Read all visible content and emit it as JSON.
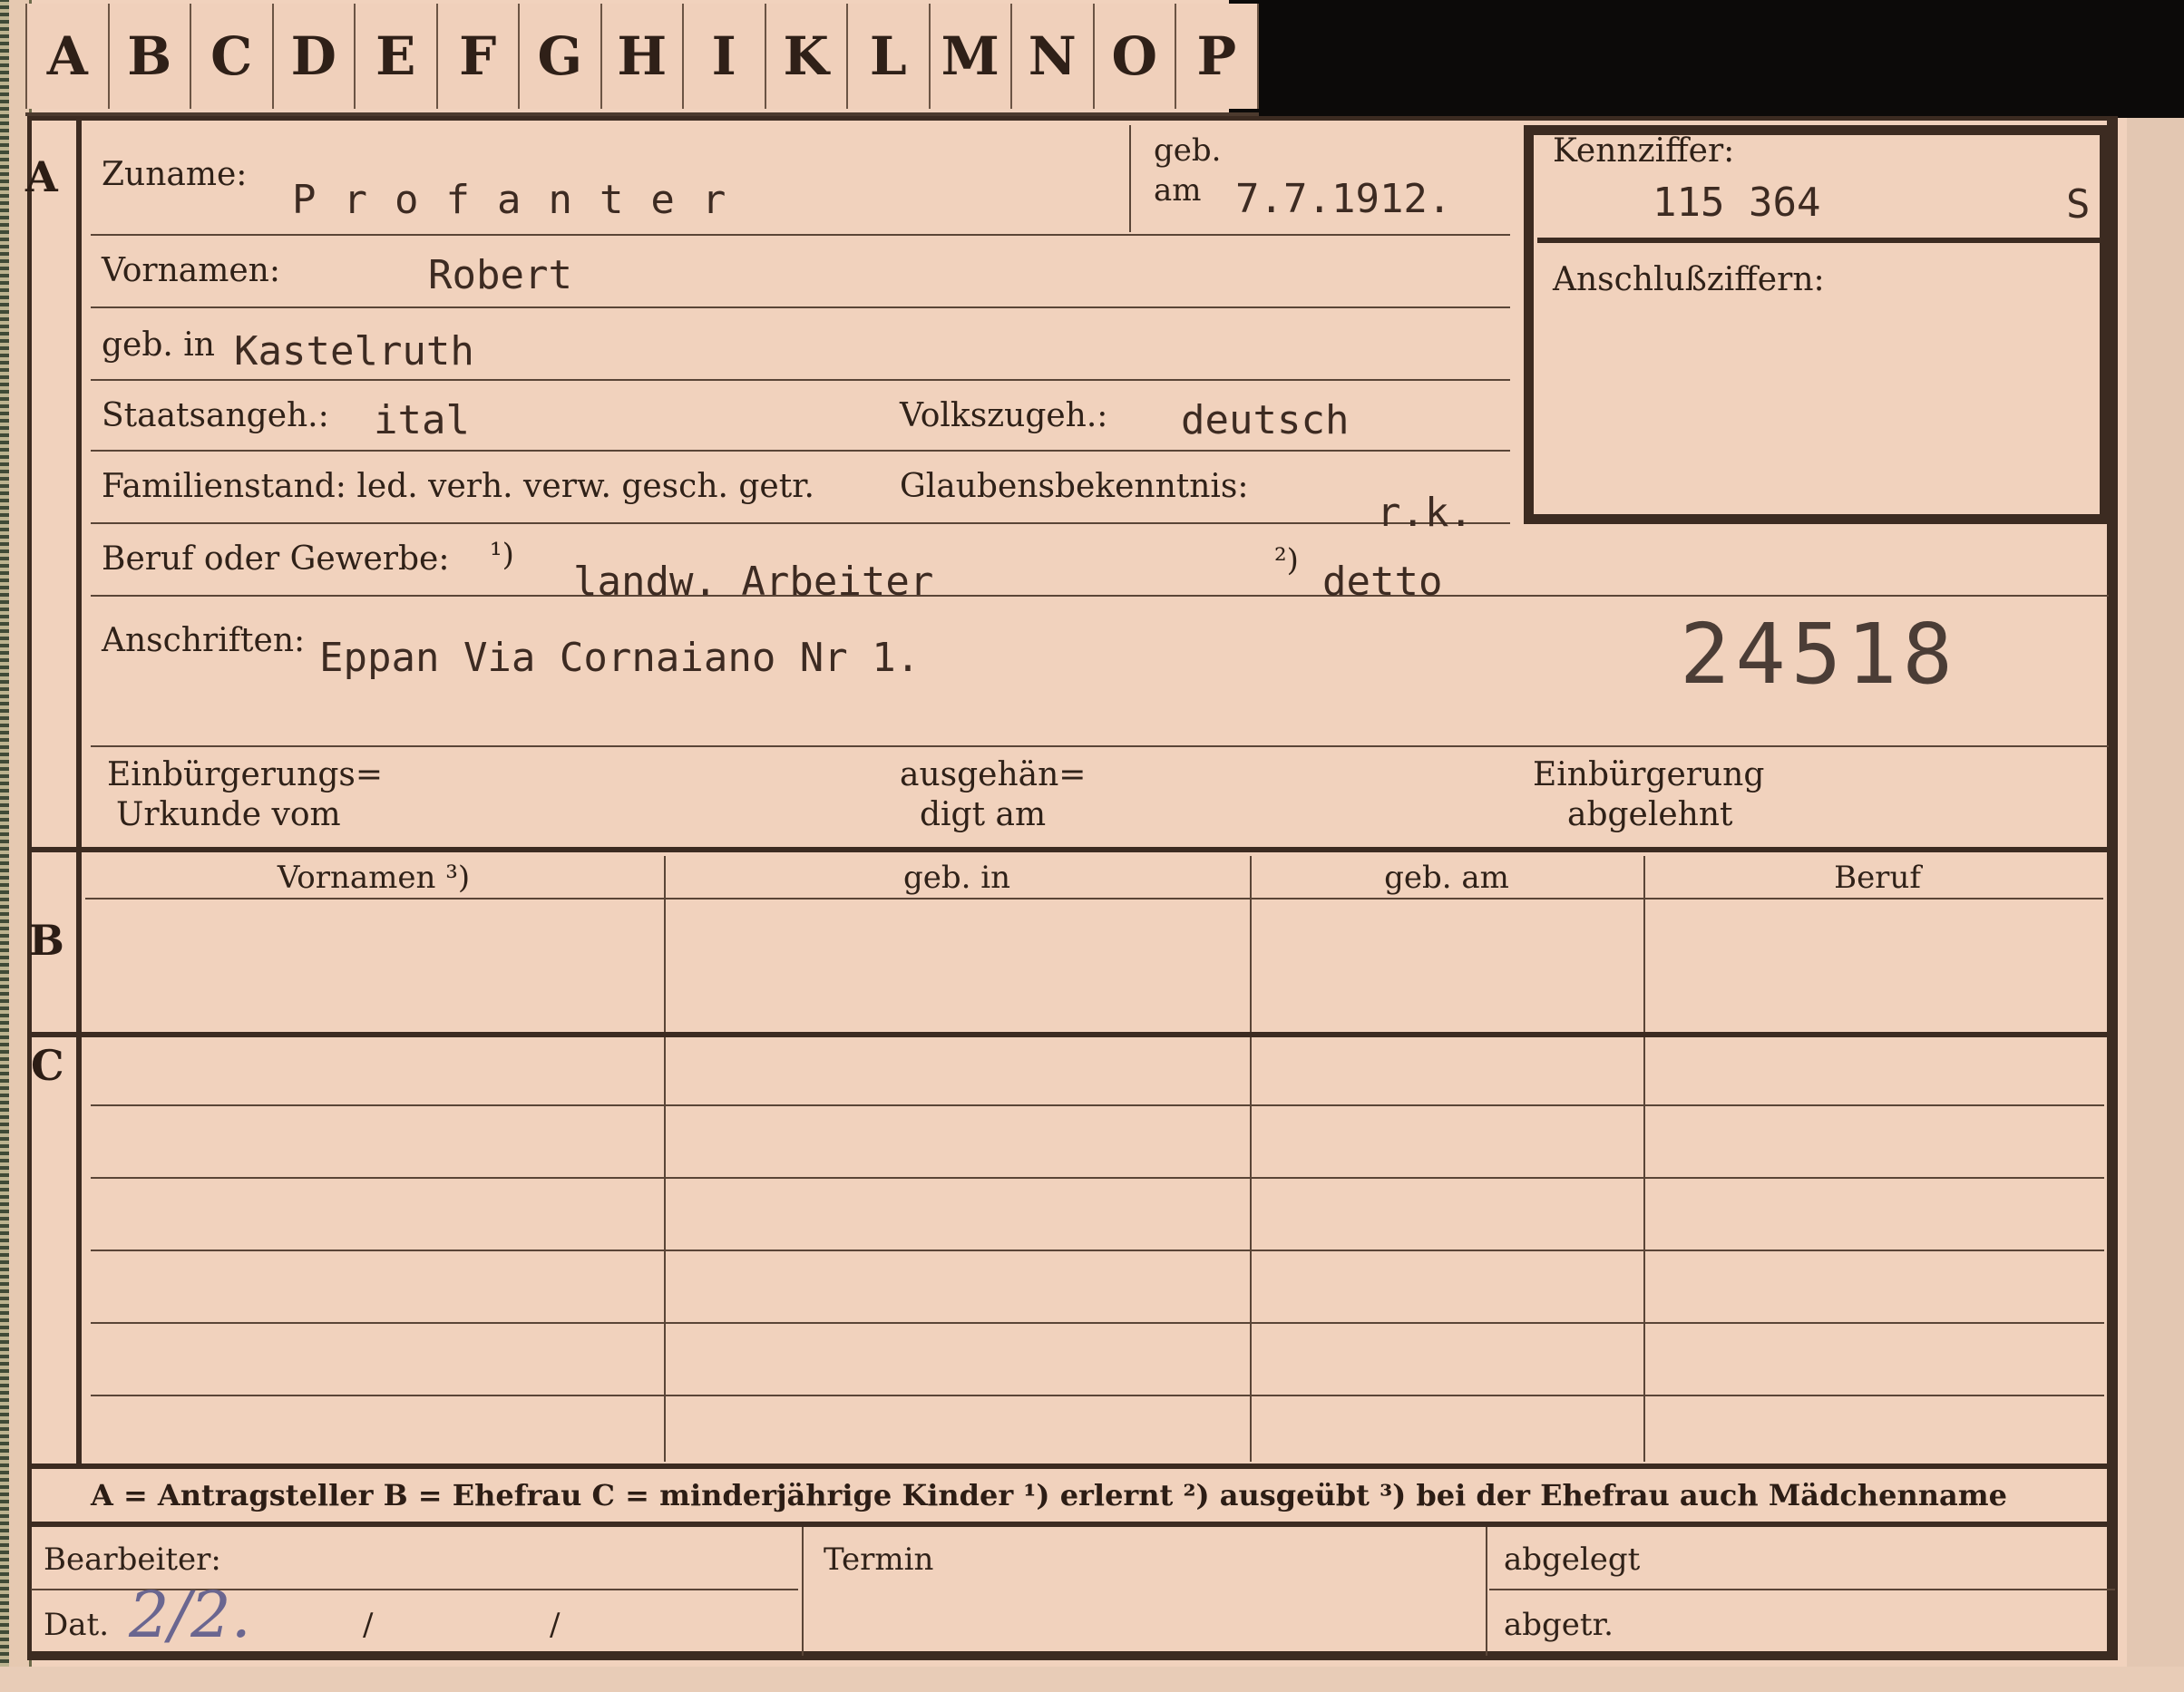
{
  "tabs": [
    "A",
    "B",
    "C",
    "D",
    "E",
    "F",
    "G",
    "H",
    "I",
    "K",
    "L",
    "M",
    "N",
    "O",
    "P"
  ],
  "section_a": {
    "label": "A",
    "zuname_label": "Zuname:",
    "zuname": "Profanter",
    "geb_label": "geb.",
    "am_label": "am",
    "geb_am": "7.7.1912.",
    "vornamen_label": "Vornamen:",
    "vornamen": "Robert",
    "geb_in_label": "geb. in",
    "geb_in": "Kastelruth",
    "staat_label": "Staatsangeh.:",
    "staat": "ital",
    "volk_label": "Volkszugeh.:",
    "volk": "deutsch",
    "familienstand_label": "Familienstand: led. verh. verw. gesch. getr.",
    "glauben_label": "Glaubensbekenntnis:",
    "glauben": "r.k.",
    "beruf_label": "Beruf oder Gewerbe:",
    "fn1": "¹)",
    "beruf_erlernt": "landw. Arbeiter",
    "fn2": "²)",
    "beruf_ausgeuebt": "detto",
    "anschriften_label": "Anschriften:",
    "anschrift": "Eppan Via Cornaiano Nr 1.",
    "stamp_number": "24518",
    "einb_urkunde_l1": "Einbürgerungs=",
    "einb_urkunde_l2": "Urkunde vom",
    "ausgehaendigt_l1": "ausgehän=",
    "ausgehaendigt_l2": "digt am",
    "einb_abgelehnt_l1": "Einbürgerung",
    "einb_abgelehnt_l2": "abgelehnt"
  },
  "kennziffer": {
    "label": "Kennziffer:",
    "value": "115 364",
    "suffix": "S",
    "anschluss_label": "Anschlußziffern:"
  },
  "section_b": {
    "label": "B",
    "columns": [
      "Vornamen ³)",
      "geb. in",
      "geb. am",
      "Beruf"
    ]
  },
  "section_c": {
    "label": "C"
  },
  "legend": "A = Antragsteller   B = Ehefrau   C = minderjährige Kinder   ¹) erlernt   ²) ausgeübt   ³) bei der Ehefrau auch Mädchenname",
  "footer": {
    "bearbeiter_label": "Bearbeiter:",
    "dat_label": "Dat.",
    "dat_value": "2/2.",
    "slash1": "/",
    "slash2": "/",
    "termin_label": "Termin",
    "abgelegt_label": "abgelegt",
    "abgetr_label": "abgetr."
  }
}
